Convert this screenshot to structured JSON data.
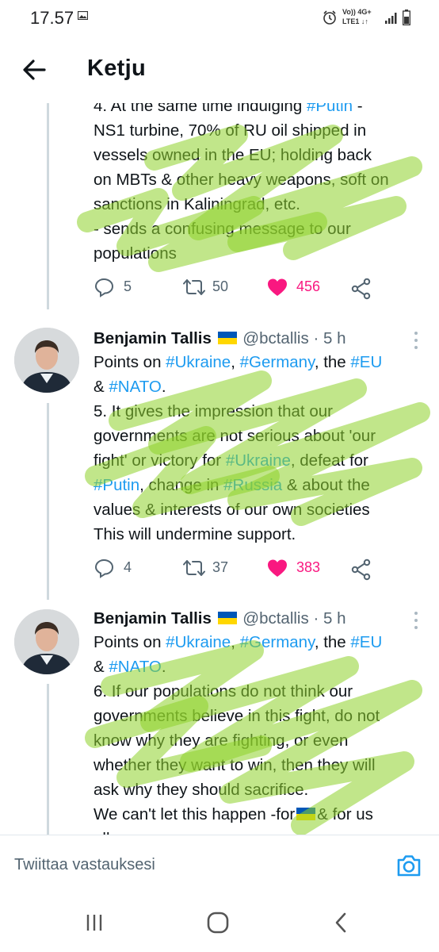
{
  "status_bar": {
    "time": "17.57",
    "network_top": "Vo))  4G+",
    "network_bottom": "LTE1 ↓↑"
  },
  "app_bar": {
    "title": "Ketju"
  },
  "tweets": [
    {
      "partial": true,
      "text_segments": [
        {
          "t": "4. At the same time indulging "
        },
        {
          "t": "#Putin",
          "tag": true
        },
        {
          "t": " -\nNS1 turbine, 70% of RU oil shipped in\nvessels owned in the EU; holding back\non MBTs & other heavy weapons, soft on\nsanctions in Kaliningrad, etc.\n- sends a confusing message to our\npopulations"
        }
      ],
      "replies": "5",
      "retweets": "50",
      "likes": "456"
    },
    {
      "author": "Benjamin Tallis",
      "handle": "@bctallis",
      "time": "· 5 h",
      "text_segments": [
        {
          "t": "Points on "
        },
        {
          "t": "#Ukraine",
          "tag": true
        },
        {
          "t": ", "
        },
        {
          "t": "#Germany",
          "tag": true
        },
        {
          "t": ", the "
        },
        {
          "t": "#EU",
          "tag": true
        },
        {
          "t": "\n& "
        },
        {
          "t": "#NATO",
          "tag": true
        },
        {
          "t": ".\n5. It gives the impression that our\ngovernments are not serious about 'our\nfight' or victory for "
        },
        {
          "t": "#Ukraine",
          "tag": true
        },
        {
          "t": ", defeat for\n"
        },
        {
          "t": "#Putin",
          "tag": true
        },
        {
          "t": ", change in "
        },
        {
          "t": "#Russia",
          "tag": true
        },
        {
          "t": " & about the\nvalues & interests of our own societies\nThis will undermine support."
        }
      ],
      "replies": "4",
      "retweets": "37",
      "likes": "383"
    },
    {
      "author": "Benjamin Tallis",
      "handle": "@bctallis",
      "time": "· 5 h",
      "text_segments": [
        {
          "t": "Points on "
        },
        {
          "t": "#Ukraine",
          "tag": true
        },
        {
          "t": ", "
        },
        {
          "t": "#Germany",
          "tag": true
        },
        {
          "t": ", the "
        },
        {
          "t": "#EU",
          "tag": true
        },
        {
          "t": "\n& "
        },
        {
          "t": "#NATO",
          "tag": true
        },
        {
          "t": ".\n6. If our populations do not think our\ngovernments believe in this fight, do not\nknow why they are fighting, or even\nwhether they want to win, then they will\nask why they should sacrifice.\nWe can't let this happen -for"
        },
        {
          "t": "🇺🇦",
          "flag": true
        },
        {
          "t": "& for us\nall"
        }
      ]
    }
  ],
  "reply_bar": {
    "placeholder": "Twiittaa vastauksesi"
  },
  "colors": {
    "accent": "#1d9bf0",
    "like": "#f91880",
    "highlight": "#8ed12a",
    "muted": "#536471"
  },
  "icons": [
    "back-arrow-icon",
    "reply-icon",
    "retweet-icon",
    "heart-icon",
    "share-icon",
    "more-icon",
    "camera-icon",
    "recents-icon",
    "home-icon",
    "back-icon"
  ]
}
